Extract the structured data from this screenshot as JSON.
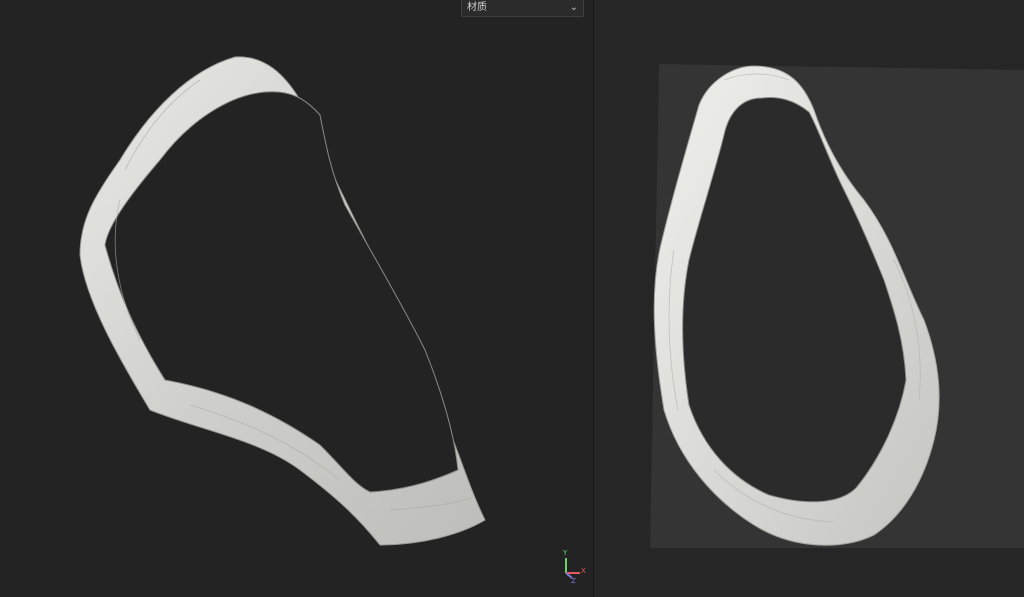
{
  "material_dropdown": {
    "selected": "材质",
    "chevron_icon": "chevron-down-icon"
  },
  "axis_gizmo": {
    "y": "Y",
    "x": "X",
    "z": "Z",
    "colors": {
      "y": "#6ad36a",
      "x": "#e05a5a",
      "z": "#7a7ad8"
    }
  },
  "left_viewport": {
    "content": "3d-model-ring-perspective"
  },
  "right_viewport": {
    "content": "3d-model-ring-top-on-plane"
  }
}
